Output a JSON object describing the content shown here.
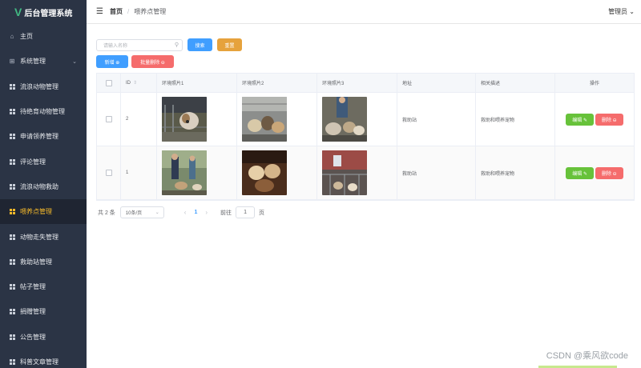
{
  "app": {
    "title": "后台管理系统",
    "logo": "V"
  },
  "sidebar": {
    "items": [
      {
        "label": "主页",
        "icon": "home-icon"
      },
      {
        "label": "系统管理",
        "icon": "settings-grid-icon",
        "has_arrow": true
      },
      {
        "label": "流浪动物管理",
        "icon": "grid-icon"
      },
      {
        "label": "待绝育动物管理",
        "icon": "grid-icon"
      },
      {
        "label": "申请领养管理",
        "icon": "grid-icon"
      },
      {
        "label": "评论管理",
        "icon": "grid-icon"
      },
      {
        "label": "流浪动物救助",
        "icon": "grid-icon"
      },
      {
        "label": "喂养点管理",
        "icon": "grid-icon",
        "active": true
      },
      {
        "label": "动物走失管理",
        "icon": "grid-icon"
      },
      {
        "label": "救助站管理",
        "icon": "grid-icon"
      },
      {
        "label": "帖子管理",
        "icon": "grid-icon"
      },
      {
        "label": "捐赠管理",
        "icon": "grid-icon"
      },
      {
        "label": "公告管理",
        "icon": "grid-icon"
      },
      {
        "label": "科普文章管理",
        "icon": "grid-icon"
      }
    ]
  },
  "header": {
    "breadcrumb_home": "首页",
    "breadcrumb_sep": "/",
    "breadcrumb_current": "喂养点管理",
    "user_label": "管理员",
    "user_caret": "⌄"
  },
  "toolbar": {
    "search_placeholder": "请输入名称",
    "search_button": "搜索",
    "reset_button": "重置",
    "add_button": "新增 ⊕",
    "batch_delete_button": "批量删除 ⊖"
  },
  "table": {
    "headers": [
      "ID",
      "环境照片1",
      "环境照片2",
      "环境照片3",
      "地址",
      "相关描述",
      "操作"
    ],
    "rows": [
      {
        "id": "2",
        "address": "救助站",
        "description": "救助和喂养宠物"
      },
      {
        "id": "1",
        "address": "救助站",
        "description": "救助和喂养宠物"
      }
    ],
    "edit_label": "编辑 ✎",
    "delete_label": "删除 ⊖"
  },
  "pagination": {
    "total_text": "共 2 条",
    "page_size": "10条/页",
    "current_page": "1",
    "goto_label": "前往",
    "goto_value": "1",
    "page_suffix": "页"
  },
  "watermark": "CSDN @乘风欲code",
  "colors": {
    "sidebar_bg": "#2b3445",
    "active_menu": "#f7ba2a",
    "primary": "#409eff",
    "warning": "#e6a23c",
    "danger": "#f56c6c",
    "success": "#67c23a"
  }
}
